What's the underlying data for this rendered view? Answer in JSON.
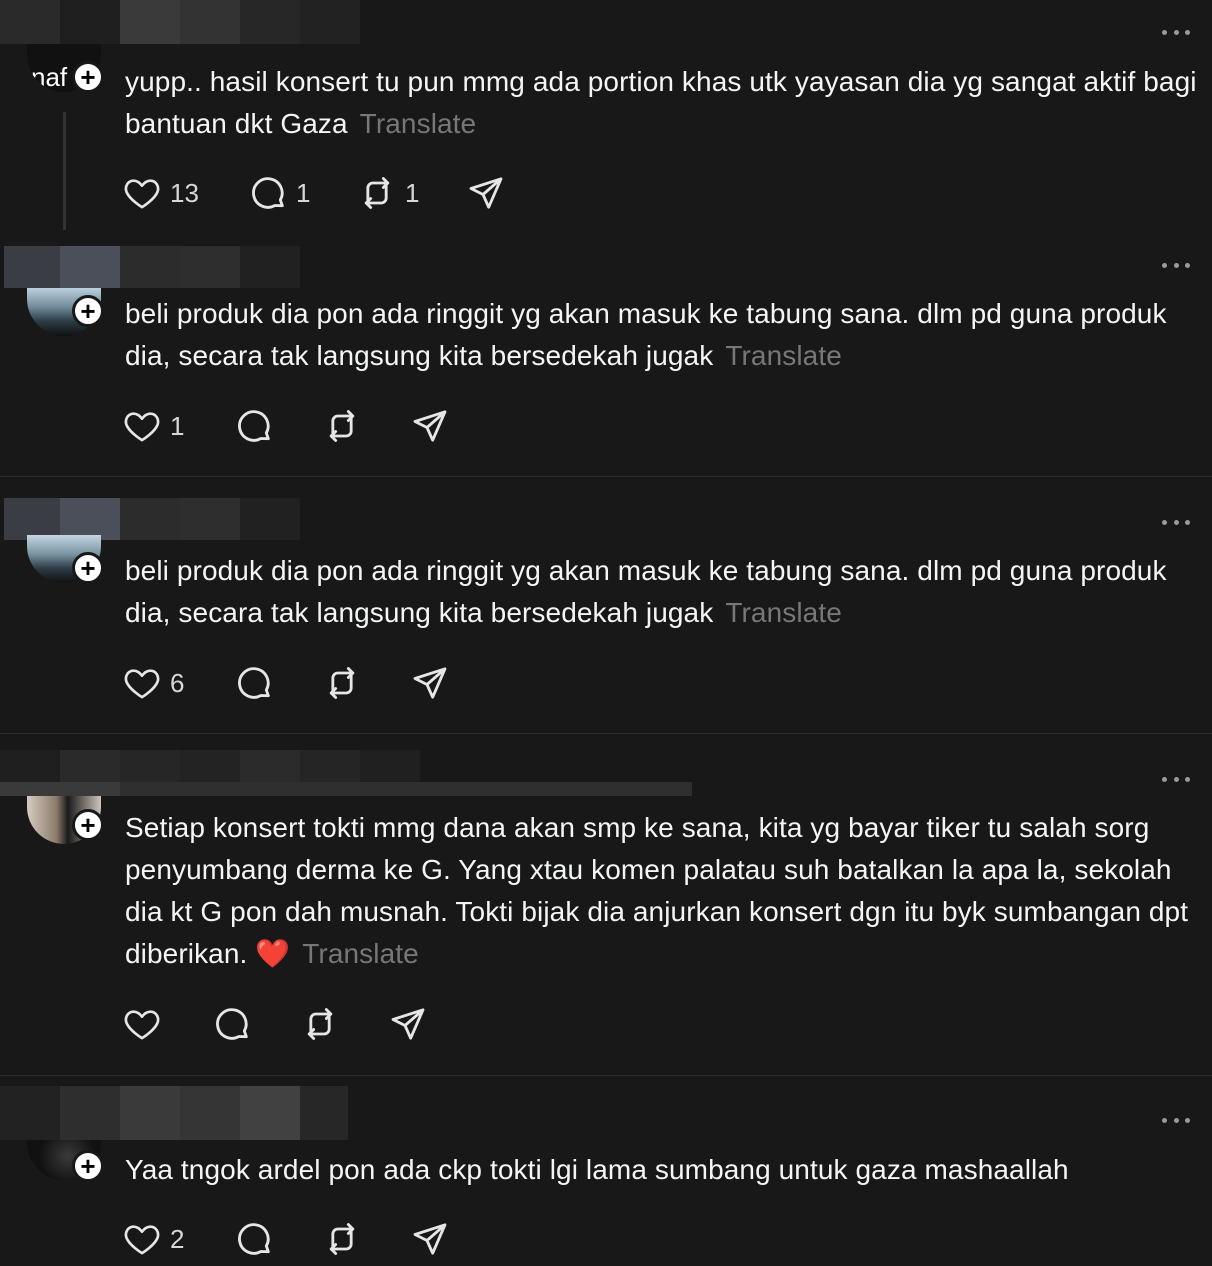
{
  "posts": [
    {
      "avatar_partial_text": "naf",
      "text": "yupp.. hasil konsert tu pun mmg ada portion khas utk yayasan dia yg sangat aktif bagi bantuan dkt Gaza",
      "translate_label": "Translate",
      "likes": "13",
      "replies": "1",
      "reposts": "1"
    },
    {
      "text": "beli produk dia pon ada ringgit yg akan masuk ke tabung sana. dlm pd guna produk dia, secara tak langsung kita bersedekah jugak",
      "translate_label": "Translate",
      "likes": "1",
      "replies": "",
      "reposts": ""
    },
    {
      "text": "beli produk dia pon ada ringgit yg akan masuk ke tabung sana. dlm pd guna produk dia, secara tak langsung kita bersedekah jugak",
      "translate_label": "Translate",
      "likes": "6",
      "replies": "",
      "reposts": ""
    },
    {
      "text": "Setiap konsert tokti mmg dana akan smp ke sana, kita yg bayar tiker tu salah sorg penyumbang derma ke G. Yang xtau komen palatau suh batalkan la apa la, sekolah dia kt G pon dah musnah. Tokti bijak dia anjurkan konsert dgn itu byk sumbangan dpt diberikan. ❤️",
      "translate_label": "Translate",
      "likes": "",
      "replies": "",
      "reposts": ""
    },
    {
      "text": "Yaa tngok ardel pon ada ckp tokti lgi lama sumbang untuk gaza mashaallah",
      "translate_label": "",
      "likes": "2",
      "replies": "",
      "reposts": ""
    }
  ],
  "icons": {
    "like": "heart-icon",
    "reply": "comment-icon",
    "repost": "repost-icon",
    "share": "send-icon",
    "more": "more-icon",
    "follow": "plus-icon"
  },
  "colors": {
    "background": "#181818",
    "text": "#f3f5f7",
    "translate": "#777777",
    "divider": "#2d2d2d"
  }
}
